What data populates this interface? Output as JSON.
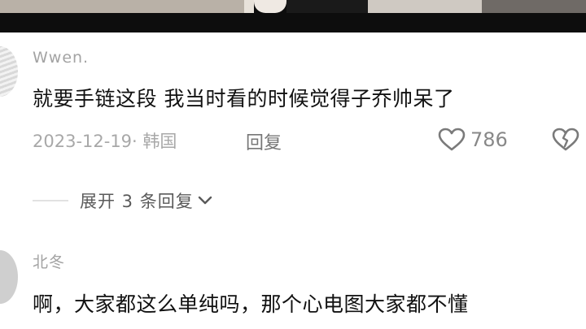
{
  "comments": [
    {
      "username": "Wwen.",
      "text": "就要手链这段 我当时看的时候觉得子乔帅呆了",
      "meta": "2023-12-19· 韩国",
      "reply_label": "回复",
      "likes": "786",
      "expand_label": "展开 3 条回复"
    },
    {
      "username": "北冬",
      "text": "啊，大家都这么单纯吗，那个心电图大家都不懂"
    }
  ],
  "icons": {
    "like": "heart-outline-icon",
    "dislike": "broken-heart-icon",
    "expand": "chevron-down-icon"
  },
  "colors": {
    "background": "#ffffff",
    "text": "#111111",
    "muted": "#a8a8a8",
    "video_band": "#0d0d0d"
  }
}
